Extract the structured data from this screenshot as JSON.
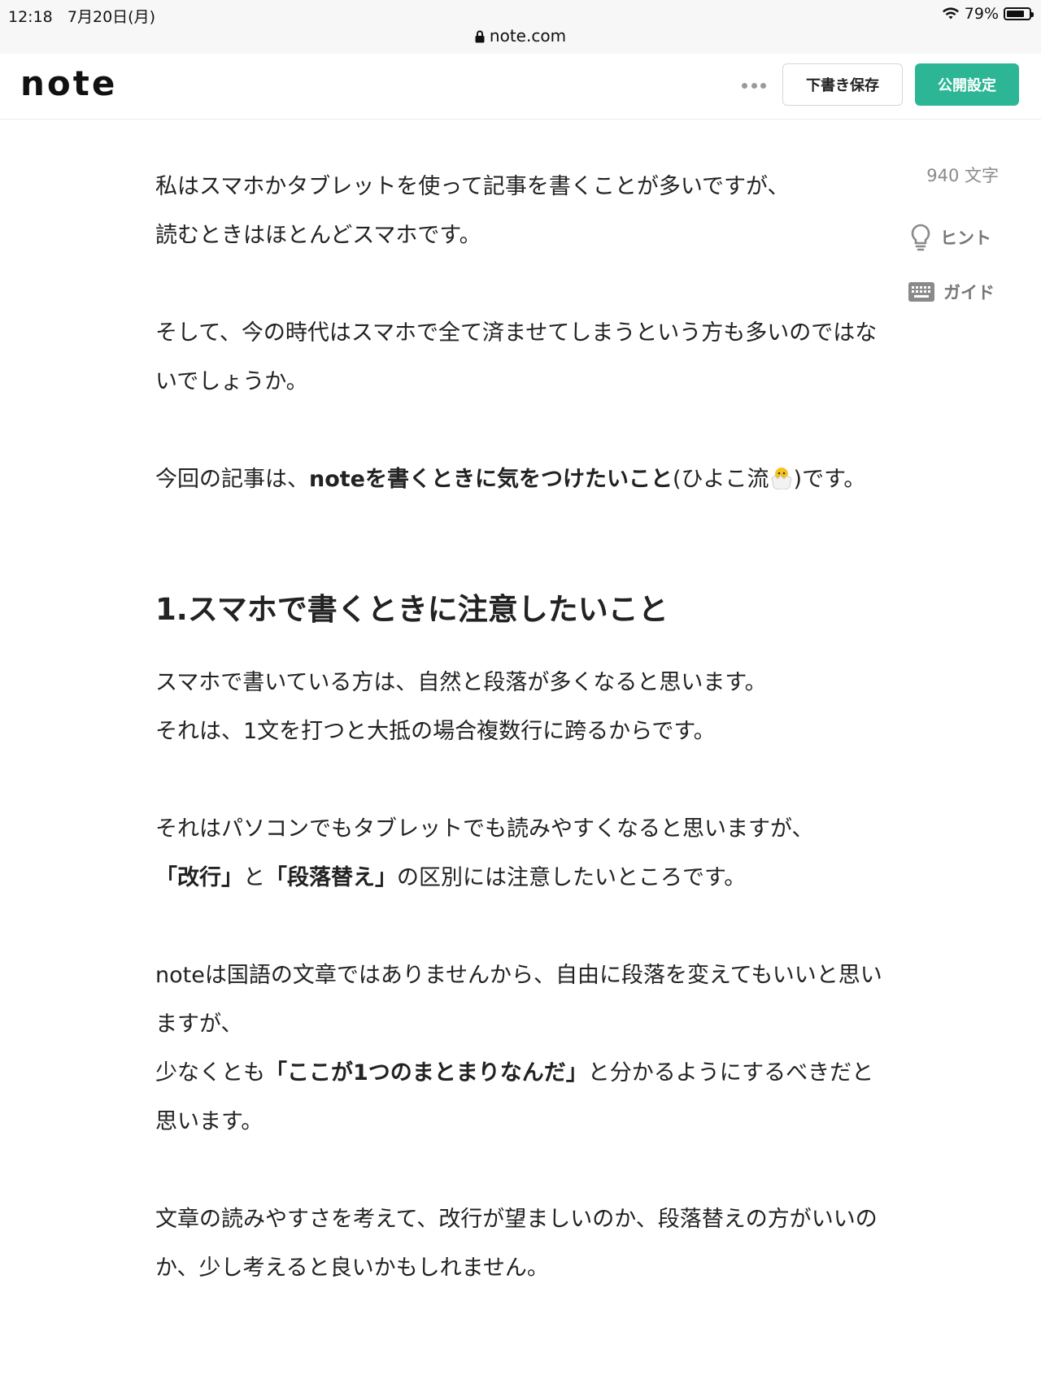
{
  "status_bar": {
    "time": "12:18",
    "date": "7月20日(月)",
    "battery": "79%",
    "battery_level": 0.79
  },
  "browser": {
    "url": "note.com"
  },
  "header": {
    "logo": "note",
    "draft_button": "下書き保存",
    "publish_button": "公開設定"
  },
  "sidebar": {
    "char_count": "940 文字",
    "hint_label": "ヒント",
    "guide_label": "ガイド"
  },
  "colors": {
    "accent": "#2cb696"
  },
  "article": {
    "p1_line1": "私はスマホかタブレットを使って記事を書くことが多いですが、",
    "p1_line2": "読むときはほとんどスマホです。",
    "p2": "そして、今の時代はスマホで全て済ませてしまうという方も多いのではないでしょうか。",
    "p3_a": "今回の記事は、",
    "p3_bold": "noteを書くときに気をつけたいこと",
    "p3_b": "(ひよこ流",
    "p3_c": ")です。",
    "heading": "1.スマホで書くときに注意したいこと",
    "p4_line1": "スマホで書いている方は、自然と段落が多くなると思います。",
    "p4_line2": "それは、1文を打つと大抵の場合複数行に跨るからです。",
    "p5_a": "それはパソコンでもタブレットでも読みやすくなると思いますが、",
    "p5_bold1": "「改行」",
    "p5_b": "と",
    "p5_bold2": "「段落替え」",
    "p5_c": "の区別には注意したいところです。",
    "p6_line1": "noteは国語の文章ではありませんから、自由に段落を変えてもいいと思いますが、",
    "p6_a": "少なくとも",
    "p6_bold": "「ここが1つのまとまりなんだ」",
    "p6_b": "と分かるようにするべきだと思います。",
    "p7": "文章の読みやすさを考えて、改行が望ましいのか、段落替えの方がいいのか、少し考えると良いかもしれません。"
  }
}
